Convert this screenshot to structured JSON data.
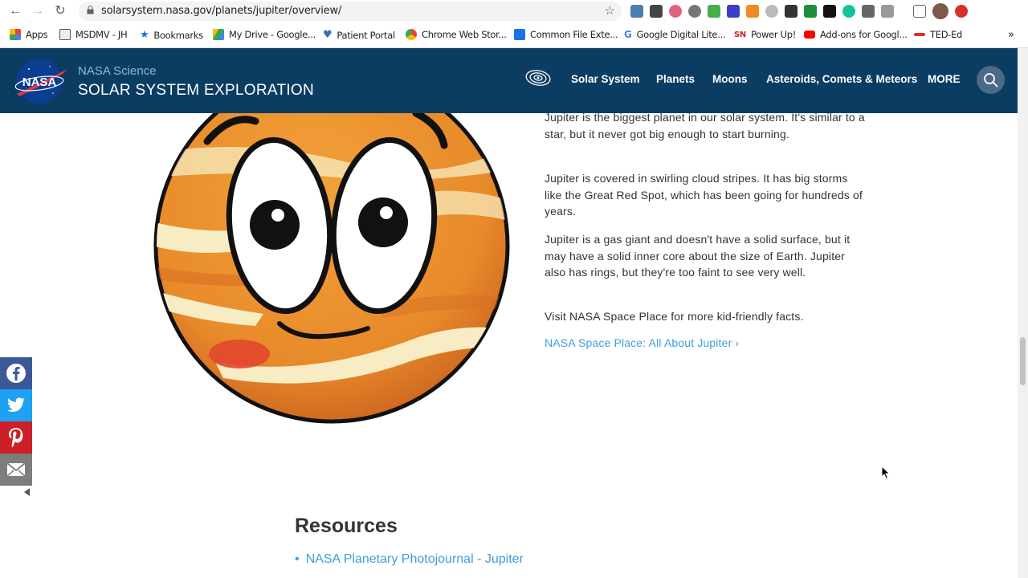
{
  "browser": {
    "url": "solarsystem.nasa.gov/planets/jupiter/overview/",
    "bookmarks": [
      "Apps",
      "MSDMV - JH",
      "Bookmarks",
      "My Drive - Google...",
      "Patient Portal",
      "Chrome Web Stor...",
      "Common File Exte...",
      "Google Digital Lite...",
      "Power Up!",
      "Add-ons for Googl...",
      "TED-Ed"
    ],
    "more_bookmarks": "»"
  },
  "header": {
    "brand_small": "NASA Science",
    "brand_big": "SOLAR SYSTEM EXPLORATION",
    "logo_text": "NASA",
    "nav": [
      "Solar System",
      "Planets",
      "Moons",
      "Asteroids, Comets & Meteors",
      "MORE"
    ]
  },
  "main": {
    "paragraphs": [
      "Jupiter is the biggest planet in our solar system. It's similar to a star, but it never got big enough to start burning.",
      "Jupiter is covered in swirling cloud stripes. It has big storms like the Great Red Spot, which has been going for hundreds of years.",
      "Jupiter is a gas giant and doesn't have a solid surface, but it may have a solid inner core about the size of Earth. Jupiter also has rings, but they're too faint to see very well.",
      "Visit NASA Space Place for more kid-friendly facts."
    ],
    "space_place_link": "NASA Space Place: All About Jupiter ›"
  },
  "resources": {
    "title": "Resources",
    "items": [
      "NASA Planetary Photojournal - Jupiter"
    ]
  },
  "social": [
    "facebook",
    "twitter",
    "pinterest",
    "email"
  ],
  "colors": {
    "header_bg": "#0b3d63",
    "link": "#3f9ed8",
    "facebook": "#3b5998",
    "twitter": "#1da1f2",
    "pinterest": "#cb2027",
    "email": "#7d7d7d"
  }
}
